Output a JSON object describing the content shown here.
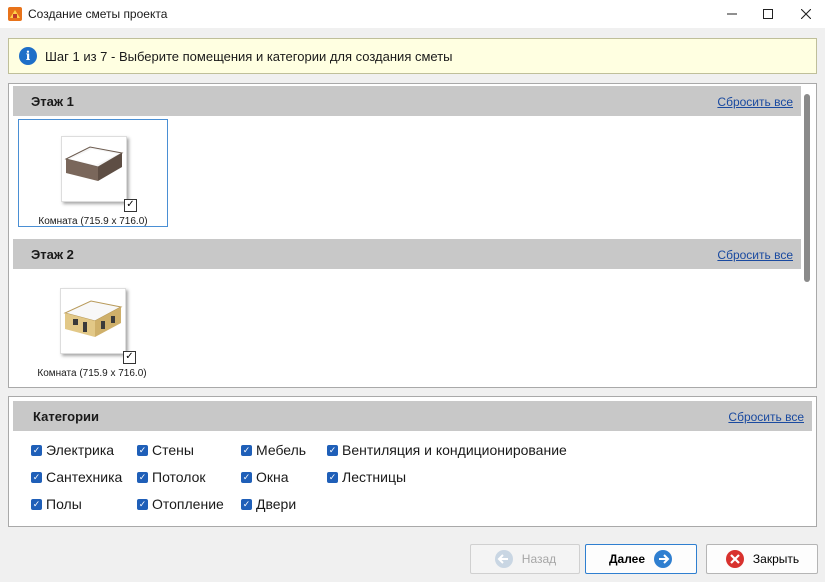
{
  "window": {
    "title": "Создание сметы проекта"
  },
  "info": {
    "message": "Шаг 1 из 7 - Выберите помещения и категории для создания сметы"
  },
  "floors": [
    {
      "title": "Этаж 1",
      "reset_label": "Сбросить все",
      "rooms": [
        {
          "label": "Комната (715.9 x 716.0)",
          "checked": true
        }
      ]
    },
    {
      "title": "Этаж 2",
      "reset_label": "Сбросить все",
      "rooms": [
        {
          "label": "Комната (715.9 x 716.0)",
          "checked": true
        }
      ]
    }
  ],
  "categories": {
    "title": "Категории",
    "reset_label": "Сбросить все",
    "items": [
      {
        "label": "Электрика",
        "checked": true
      },
      {
        "label": "Стены",
        "checked": true
      },
      {
        "label": "Мебель",
        "checked": true
      },
      {
        "label": "Вентиляция и кондиционирование",
        "checked": true
      },
      {
        "label": "Сантехника",
        "checked": true
      },
      {
        "label": "Потолок",
        "checked": true
      },
      {
        "label": "Окна",
        "checked": true
      },
      {
        "label": "Лестницы",
        "checked": true
      },
      {
        "label": "Полы",
        "checked": true
      },
      {
        "label": "Отопление",
        "checked": true
      },
      {
        "label": "Двери",
        "checked": true
      }
    ]
  },
  "footer": {
    "back_label": "Назад",
    "next_label": "Далее",
    "close_label": "Закрыть"
  },
  "colors": {
    "accent": "#1f5fb8",
    "info_bg": "#ffffe1",
    "header_bg": "#c8c8c8"
  }
}
